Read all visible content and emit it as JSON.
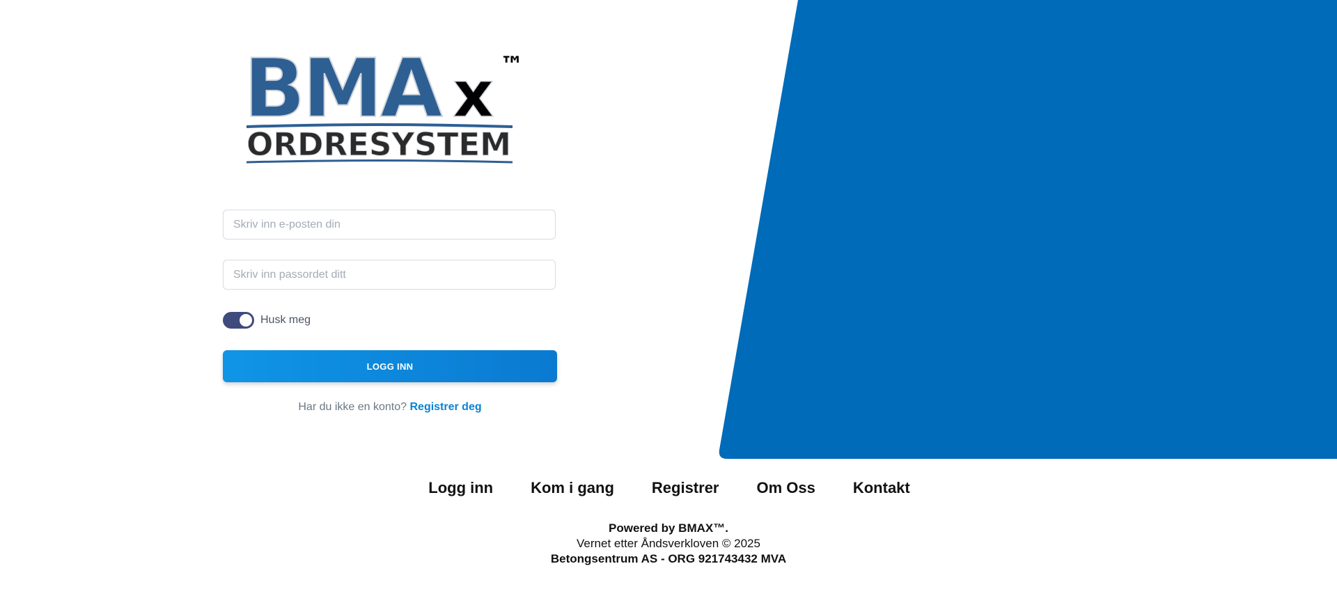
{
  "logo": {
    "text_main": "BMA",
    "text_x": "x",
    "text_tm": "™",
    "text_sub": "ORDRESYSTEM"
  },
  "form": {
    "email_placeholder": "Skriv inn e-posten din",
    "password_placeholder": "Skriv inn passordet ditt",
    "remember_label": "Husk meg",
    "remember_checked": true,
    "login_button": "LOGG INN",
    "signup_prompt": "Har du ikke en konto?",
    "signup_link": "Registrer deg"
  },
  "footer": {
    "nav": [
      {
        "label": "Logg inn"
      },
      {
        "label": "Kom i gang"
      },
      {
        "label": "Registrer"
      },
      {
        "label": "Om Oss"
      },
      {
        "label": "Kontakt"
      }
    ],
    "powered_by": "Powered by BMAX™.",
    "copyright": "Vernet etter Åndsverkloven © 2025",
    "company": "Betongsentrum AS - ORG 921743432 MVA"
  },
  "colors": {
    "brand_blue": "#006bb8",
    "logo_blue": "#2e5f93",
    "button_blue": "#0a7ad1",
    "toggle": "#3f4a7d"
  }
}
